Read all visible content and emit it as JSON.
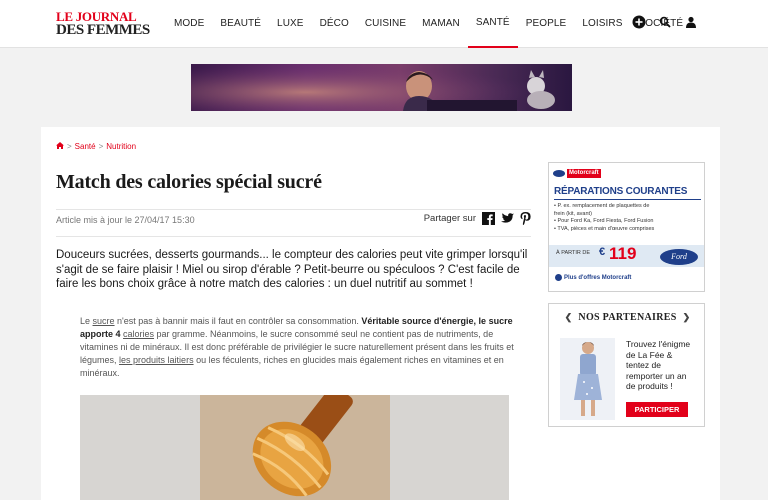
{
  "header": {
    "logo_line1": "LE JOURNAL",
    "logo_line2": "DES FEMMES",
    "nav": [
      "MODE",
      "BEAUTÉ",
      "LUXE",
      "DÉCO",
      "CUISINE",
      "MAMAN",
      "SANTÉ",
      "PEOPLE",
      "LOISIRS",
      "SOCIÉTÉ"
    ],
    "active_nav": "SANTÉ",
    "icons": [
      "plus-circle-icon",
      "search-icon",
      "user-icon"
    ]
  },
  "breadcrumb": {
    "home_icon": "home-icon",
    "items": [
      "Santé",
      "Nutrition"
    ]
  },
  "article": {
    "title": "Match des calories spécial sucré",
    "meta_date": "Article mis à jour le 27/04/17 15:30",
    "share_label": "Partager sur",
    "lead": "Douceurs sucrées, desserts gourmands... le compteur des calories peut vite grimper lorsqu'il s'agit de se faire plaisir ! Miel ou sirop d'érable ? Petit-beurre ou spéculoos ? C'est facile de faire les bons choix grâce à notre match des calories : un duel nutritif au sommet !",
    "body": {
      "p1_a": "Le ",
      "p1_link1": "sucre",
      "p1_b": " n'est pas à bannir mais il faut en contrôler sa consommation. ",
      "p1_bold1": "Véritable source d'énergie, le sucre apporte 4 ",
      "p1_link2": "calories",
      "p1_c": " par gramme. Néanmoins, le sucre consommé seul ne contient pas de nutriments, de vitamines ni de minéraux. Il est donc préférable de privilégier le sucre naturellement présent dans les fruits et légumes, ",
      "p1_link3": "les produits laitiers",
      "p1_d": " ou les féculents, riches en glucides mais également riches en vitamines et en minéraux."
    }
  },
  "sidebar_ad": {
    "brand": "Motorcraft",
    "headline": "RÉPARATIONS COURANTES",
    "items": [
      "P. ex. remplacement de plaquettes de frein (kit, avant)",
      "Pour Ford Ka, Ford Fiesta, Ford Fusion",
      "TVA, pièces et main d'œuvre comprises"
    ],
    "price_prefix": "À PARTIR DE",
    "currency": "€",
    "price": "119",
    "ford_logo": "Ford",
    "more_offers": "Plus d'offres Motorcraft"
  },
  "partners": {
    "title": "NOS PARTENAIRES",
    "text": "Trouvez l'énigme de La Fée & tentez de remporter un an de produits !",
    "button": "PARTICIPER"
  },
  "colors": {
    "brand_red": "#e2001a",
    "ford_blue": "#1f3f8a"
  }
}
